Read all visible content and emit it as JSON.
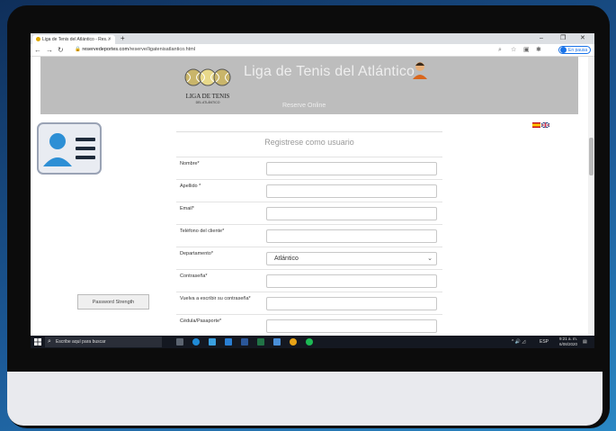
{
  "browser": {
    "tab_title": "Liga de Tenis del Atlántico - Res...",
    "tab_close": "×",
    "new_tab": "+",
    "url_domain": "reservedeportes.com",
    "url_path": "/reserve/ligatenisatlantico.html",
    "minimize": "–",
    "maximize": "❐",
    "close": "✕",
    "pause_label": "En pausa"
  },
  "site": {
    "logo_text": "LIGA DE TENIS",
    "logo_sub": "DEL ATLÁNTICO",
    "title": "Liga de Tenis del Atlántico",
    "nav_reserve": "Reserve Online"
  },
  "form": {
    "heading": "Registrese como usuario",
    "fields": [
      {
        "label": "Nombre*",
        "value": ""
      },
      {
        "label": "Apellido *",
        "value": ""
      },
      {
        "label": "Email*",
        "value": ""
      },
      {
        "label": "Teléfono del cliente*",
        "value": ""
      },
      {
        "label": "Departamento*",
        "value": "Atlántico"
      },
      {
        "label": "Contraseña*",
        "value": ""
      },
      {
        "label": "Vuelva a escribir su contraseña*",
        "value": ""
      },
      {
        "label": "Cédula/Pasaporte*",
        "value": ""
      }
    ],
    "password_strength": "Password Strength"
  },
  "taskbar": {
    "search_placeholder": "Escribe aquí para buscar",
    "lang": "ESP",
    "time": "9:21 a. m.",
    "date": "6/08/2020"
  },
  "colors": {
    "header_gray": "#bdbdbd",
    "accent_blue": "#1a73e8",
    "taskbar": "#141821"
  }
}
